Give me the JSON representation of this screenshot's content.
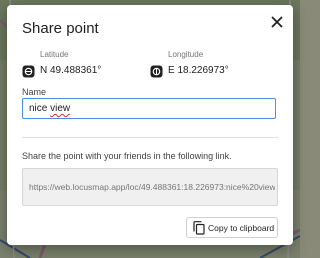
{
  "dialog": {
    "title": "Share point",
    "close_icon": "close-icon"
  },
  "coordinates": {
    "latitude": {
      "label": "Latitude",
      "value": "N 49.488361°",
      "icon": "latitude-icon"
    },
    "longitude": {
      "label": "Longitude",
      "value": "E 18.226973°",
      "icon": "longitude-icon"
    }
  },
  "name_field": {
    "label": "Name",
    "value": "nice view",
    "value_first": "nice ",
    "value_misspelled": "view"
  },
  "share": {
    "description": "Share the point with your friends in the following link.",
    "link": "https://web.locusmap.app/loc/49.488361:18.226973:nice%20view",
    "copy_label": "Copy to clipboard",
    "copy_icon": "copy-icon"
  },
  "colors": {
    "accent": "#4a90e2",
    "spellcheck": "#d93025"
  }
}
